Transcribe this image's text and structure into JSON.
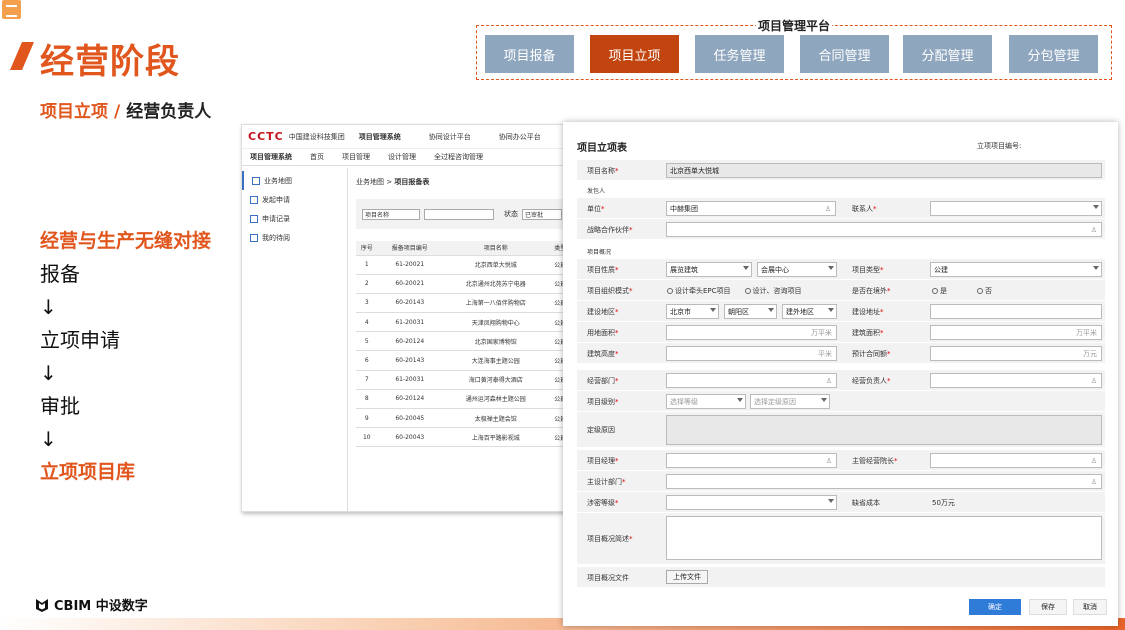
{
  "title": "经营阶段",
  "subtitle": {
    "left": "项目立项",
    "sep": "/",
    "right": "经营负责人"
  },
  "platform": {
    "label": "项目管理平台",
    "buttons": [
      "项目报备",
      "项目立项",
      "任务管理",
      "合同管理",
      "分配管理",
      "分包管理"
    ],
    "active_index": 1,
    "colors": {
      "normal": "#8fa6bf",
      "active": "#c2440f"
    }
  },
  "flow": {
    "heading": "经营与生产无缝对接",
    "steps": [
      "报备",
      "↓",
      "立项申请",
      "↓",
      "审批",
      "↓"
    ],
    "final": "立项项目库"
  },
  "logo": "CBIM 中设数字",
  "back_window": {
    "brand": "CCTC",
    "company": "中国建设科技集团",
    "top_items": [
      "项目管理系统",
      "协同设计平台",
      "协同办公平台"
    ],
    "tabs": [
      "项目管理系统",
      "首页",
      "项目管理",
      "设计管理",
      "全过程咨询管理"
    ],
    "side": [
      "业务地图",
      "发起申请",
      "申请记录",
      "我的待阅"
    ],
    "breadcrumb": {
      "root": "业务地图 >",
      "current": "项目报备表"
    },
    "filter": {
      "field": "项目名称",
      "status_label": "状态",
      "status_value": "已审批"
    },
    "columns": [
      "序号",
      "报备项目编号",
      "项目名称",
      "类型"
    ],
    "rows": [
      [
        "1",
        "61-20021",
        "北京西单大悦城",
        "公建"
      ],
      [
        "2",
        "60-20021",
        "北京通州北苑苏宁电器",
        "公建"
      ],
      [
        "3",
        "60-20143",
        "上海第一八佰伴购物店",
        "公建"
      ],
      [
        "4",
        "61-20031",
        "天津凤翔购物中心",
        "公建"
      ],
      [
        "5",
        "60-20124",
        "北京国家博物馆",
        "公建"
      ],
      [
        "6",
        "60-20143",
        "大连海事主题公园",
        "公建"
      ],
      [
        "7",
        "61-20031",
        "海口黄河泰得大酒店",
        "公建"
      ],
      [
        "8",
        "60-20124",
        "通州运河森林主题公园",
        "公建"
      ],
      [
        "9",
        "60-20045",
        "太极禅主题会馆",
        "公建"
      ],
      [
        "10",
        "60-20043",
        "上海百平路影视城",
        "公建"
      ]
    ]
  },
  "form": {
    "title": "项目立项表",
    "code_label": "立项项目编号:",
    "project_name_label": "项目名称",
    "project_name": "北京西单大悦城",
    "sec_client": "发包人",
    "unit_label": "单位",
    "unit_value": "中赫集团",
    "contact_label": "联系人",
    "partner_label": "战略合作伙伴",
    "sec_overview": "项目概况",
    "nature_label": "项目性质",
    "nature_1": "展览建筑",
    "nature_2": "会展中心",
    "type_label": "项目类型",
    "type_value": "公建",
    "org_label": "项目组织模式",
    "org_opt1": "设计牵头EPC项目",
    "org_opt2": "设计、咨询项目",
    "abroad_label": "是否在境外",
    "yes": "是",
    "no": "否",
    "region_label": "建设地区",
    "region_1": "北京市",
    "region_2": "朝阳区",
    "region_3": "建外地区",
    "address_label": "建设地址",
    "land_label": "用地面积",
    "land_unit": "万平米",
    "building_label": "建筑面积",
    "building_unit": "万平米",
    "height_label": "建筑高度",
    "height_unit": "平米",
    "contract_label": "预计合同额",
    "contract_unit": "万元",
    "dept_label": "经营部门",
    "manager_label": "经营负责人",
    "level_label": "项目级别",
    "level_ph": "选择等级",
    "reason_ph": "选择定级原因",
    "reason_label": "定级原因",
    "pm_label": "项目经理",
    "dean_label": "主管经营院长",
    "design_dept_label": "主设计部门",
    "secret_label": "涉密等级",
    "cost_label": "缺省成本",
    "cost_value": "50万元",
    "desc_label": "项目概况简述",
    "file_label": "项目概况文件",
    "upload": "上传文件",
    "confirm": "确定",
    "save": "保存",
    "cancel": "取消"
  }
}
